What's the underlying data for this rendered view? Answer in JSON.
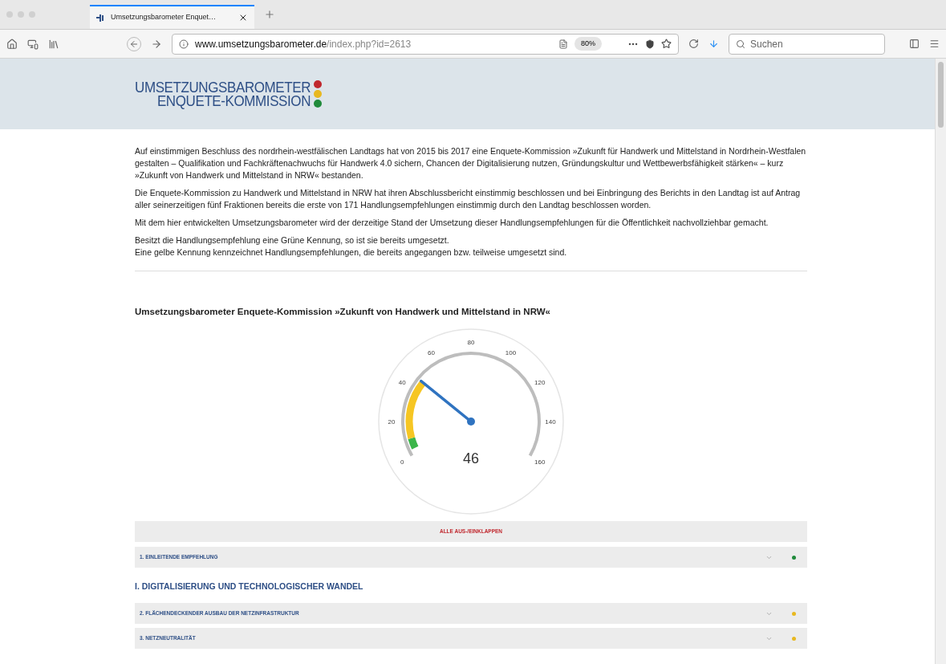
{
  "browser": {
    "tab_title": "Umsetzungsbarometer Enquet…",
    "url_host": "www.umsetzungsbarometer.de",
    "url_path": "/index.php?id=2613",
    "zoom": "80%",
    "search_placeholder": "Suchen"
  },
  "logo": {
    "line1": "UMSETZUNGSBAROMETER",
    "line2": "ENQUETE-KOMMISSION"
  },
  "intro": [
    {
      "lines": [
        "Auf einstimmigen Beschluss des nordrhein-westfälischen Landtags hat von 2015 bis 2017 eine Enquete-Kommission »Zukunft für Handwerk und Mittelstand in Nordrhein-Westfalen gestalten – Qualifikation und Fachkräftenachwuchs für Handwerk 4.0 sichern, Chancen der Digitalisierung nutzen, Gründungskultur und Wettbewerbsfähigkeit stärken« – kurz »Zukunft von Handwerk und Mittelstand in NRW« bestanden."
      ]
    },
    {
      "lines": [
        "Die Enquete-Kommission zu Handwerk und Mittelstand in NRW hat ihren Abschlussbericht einstimmig beschlossen und bei Einbringung des Berichts in den Landtag ist auf Antrag aller seinerzeitigen fünf Fraktionen bereits die erste von 171 Handlungsempfehlungen einstimmig durch den Landtag beschlossen worden."
      ]
    },
    {
      "lines": [
        "Mit dem hier entwickelten Umsetzungsbarometer wird der derzeitige Stand der Umsetzung dieser Handlungsempfehlungen für die Öffentlichkeit nachvollziehbar gemacht."
      ]
    },
    {
      "lines": [
        "Besitzt die Handlungsempfehlung eine Grüne Kennung, so ist sie bereits umgesetzt.",
        "Eine gelbe Kennung kennzeichnet Handlungsempfehlungen, die bereits angegangen bzw. teilweise umgesetzt sind."
      ]
    }
  ],
  "gauge": {
    "title": "Umsetzungsbarometer Enquete-Kommission »Zukunft von Handwerk und Mittelstand in NRW«",
    "ticks": [
      "0",
      "20",
      "40",
      "60",
      "80",
      "100",
      "120",
      "140",
      "160"
    ],
    "reading": "46",
    "level": 0.2875
  },
  "toggle_all": "ALLE AUS-/EINKLAPPEN",
  "sections": [
    {
      "kind": "item",
      "label": "1. EINLEITENDE EMPFEHLUNG",
      "color": "#1f8a3a"
    },
    {
      "kind": "heading",
      "label": "I. DIGITALISIERUNG UND TECHNOLOGISCHER WANDEL"
    },
    {
      "kind": "item",
      "label": "2. FLÄCHENDECKENDER AUSBAU DER NETZINFRASTRUKTUR",
      "color": "#e8b820"
    },
    {
      "kind": "item",
      "label": "3. NETZNEUTRALITÄT",
      "color": "#e8b820"
    }
  ]
}
